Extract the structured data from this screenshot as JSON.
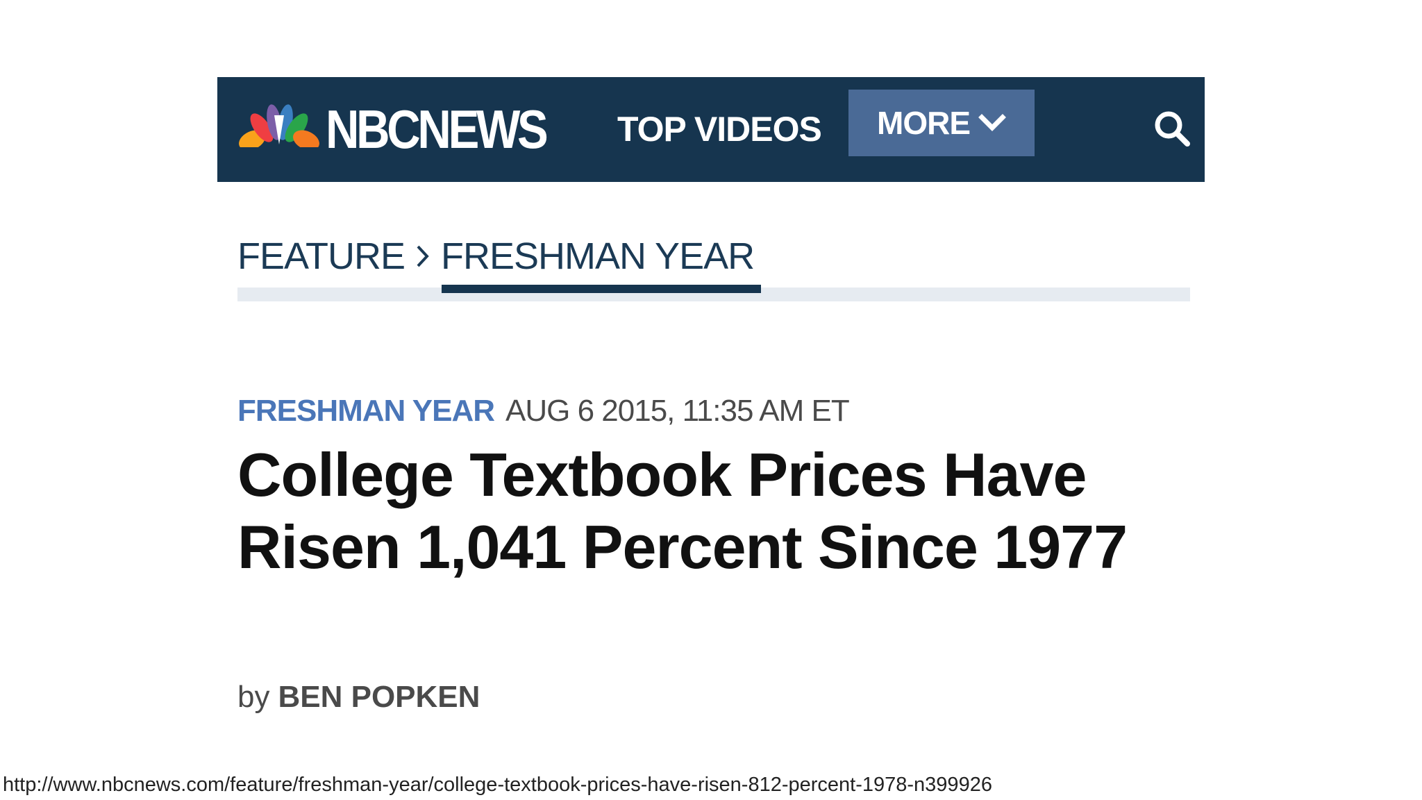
{
  "header": {
    "logo_text": "NBCNEWS",
    "nav_top_videos": "TOP VIDEOS",
    "more_label": "MORE",
    "colors": {
      "background": "#16354f",
      "more_button": "#4a6a96"
    },
    "icons": {
      "logo": "nbc-peacock-icon",
      "more": "chevron-down-icon",
      "search": "search-icon"
    }
  },
  "breadcrumb": {
    "parent": "FEATURE",
    "current": "FRESHMAN YEAR",
    "separator_icon": "chevron-right-icon"
  },
  "article": {
    "section": "FRESHMAN YEAR",
    "date": "AUG 6 2015, 11:35 AM ET",
    "headline": "College Textbook Prices Have Risen 1,041 Percent Since 1977",
    "byline_prefix": "by",
    "author": "BEN POPKEN",
    "colors": {
      "section": "#4a76b8",
      "headline": "#111111"
    }
  },
  "source_url": "http://www.nbcnews.com/feature/freshman-year/college-textbook-prices-have-risen-812-percent-1978-n399926"
}
